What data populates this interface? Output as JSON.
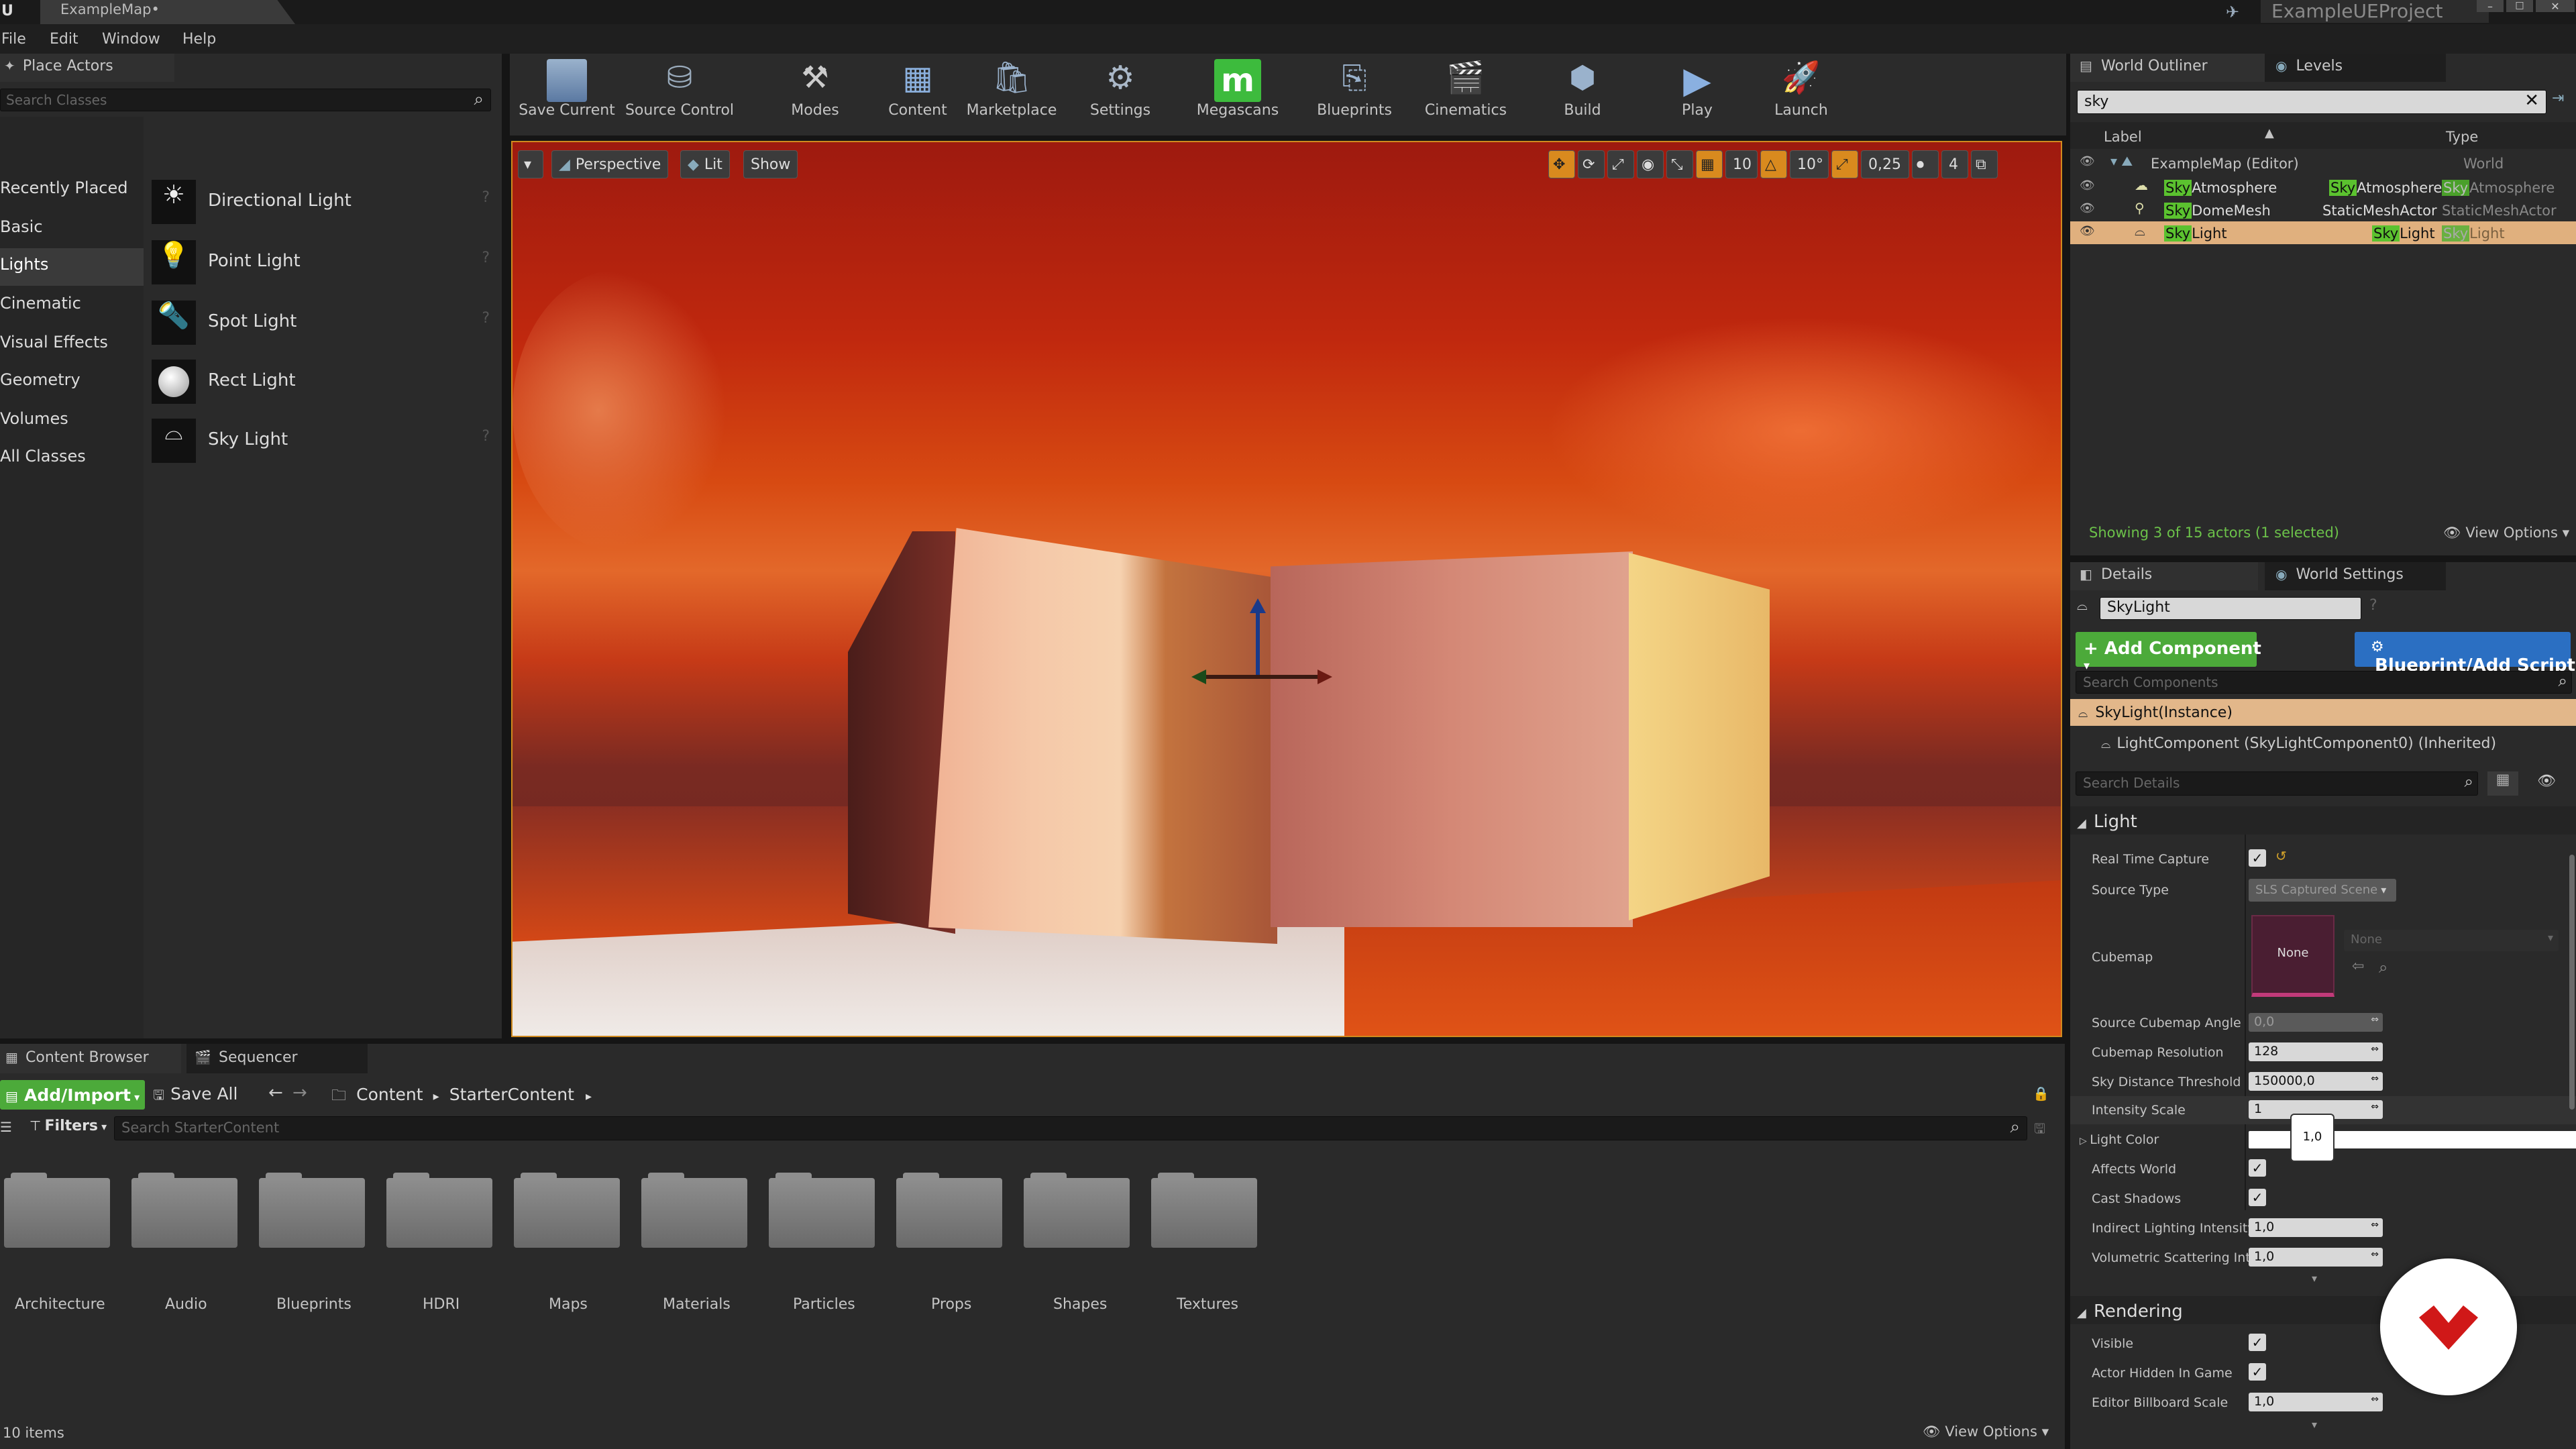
{
  "title_bar": {
    "tab": "ExampleMap",
    "project": "ExampleUEProject"
  },
  "menu": [
    "File",
    "Edit",
    "Window",
    "Help"
  ],
  "place_actors": {
    "tab": "Place Actors",
    "search_placeholder": "Search Classes",
    "categories": [
      "Recently Placed",
      "Basic",
      "Lights",
      "Cinematic",
      "Visual Effects",
      "Geometry",
      "Volumes",
      "All Classes"
    ],
    "selected_category": "Lights",
    "items": [
      "Directional Light",
      "Point Light",
      "Spot Light",
      "Rect Light",
      "Sky Light"
    ]
  },
  "toolbar": [
    "Save Current",
    "Source Control",
    "Modes",
    "Content",
    "Marketplace",
    "Settings",
    "Megascans",
    "Blueprints",
    "Cinematics",
    "Build",
    "Play",
    "Launch"
  ],
  "viewport": {
    "perspective": "Perspective",
    "lit": "Lit",
    "show": "Show",
    "grid_snap": "10",
    "rot_snap": "10°",
    "scale_snap": "0,25",
    "cam_speed": "4"
  },
  "world_outliner": {
    "tab": "World Outliner",
    "tab2": "Levels",
    "search_value": "sky",
    "col_label": "Label",
    "col_type": "Type",
    "rows": [
      {
        "label_pre": "",
        "label_hl": "",
        "label_post": "ExampleMap (Editor)",
        "type_pre": "",
        "type_hl": "",
        "type_post": "World"
      },
      {
        "label_pre": "",
        "label_hl": "Sky",
        "label_post": "Atmosphere",
        "type_pre": "",
        "type_hl": "Sky",
        "type_post": "Atmosphere"
      },
      {
        "label_pre": "",
        "label_hl": "Sky",
        "label_post": "DomeMesh",
        "type_pre": "StaticMeshActor",
        "type_hl": "",
        "type_post": ""
      },
      {
        "label_pre": "",
        "label_hl": "Sky",
        "label_post": "Light",
        "type_pre": "",
        "type_hl": "Sky",
        "type_post": "Light"
      }
    ],
    "row1_type_extra": "SkyAtmosphere",
    "row4_type_extra": "SkyLight",
    "status": "Showing 3 of 15 actors (1 selected)",
    "view_options": "View Options"
  },
  "details": {
    "tab": "Details",
    "tab2": "World Settings",
    "name": "SkyLight",
    "add_component": "+ Add Component",
    "blueprint": "Blueprint/Add Script",
    "search_components": "Search Components",
    "instance": "SkyLight(Instance)",
    "component": "LightComponent (SkyLightComponent0) (Inherited)",
    "search_details": "Search Details",
    "light_section": "Light",
    "props": {
      "real_time_capture": "Real Time Capture",
      "source_type": "Source Type",
      "source_type_value": "SLS Captured Scene",
      "cubemap": "Cubemap",
      "cubemap_value": "None",
      "cubemap_dropdown": "None",
      "source_cubemap_angle": "Source Cubemap Angle",
      "source_cubemap_angle_value": "0,0",
      "cubemap_resolution": "Cubemap Resolution",
      "cubemap_resolution_value": "128",
      "sky_distance_threshold": "Sky Distance Threshold",
      "sky_distance_threshold_value": "150000,0",
      "intensity_scale": "Intensity Scale",
      "intensity_scale_value": "1",
      "light_color": "Light Color",
      "light_color_tooltip": "1,0",
      "affects_world": "Affects World",
      "cast_shadows": "Cast Shadows",
      "indirect_lighting_intensity": "Indirect Lighting Intensity",
      "indirect_lighting_intensity_value": "1,0",
      "volumetric_scattering": "Volumetric Scattering Inte",
      "volumetric_scattering_value": "1,0"
    },
    "rendering_section": "Rendering",
    "render_props": {
      "visible": "Visible",
      "actor_hidden": "Actor Hidden In Game",
      "billboard_scale": "Editor Billboard Scale",
      "billboard_scale_value": "1,0"
    }
  },
  "content_browser": {
    "tab": "Content Browser",
    "tab2": "Sequencer",
    "add_import": "Add/Import",
    "save_all": "Save All",
    "path": [
      "Content",
      "StarterContent"
    ],
    "filters": "Filters",
    "search_placeholder": "Search StarterContent",
    "folders": [
      "Architecture",
      "Audio",
      "Blueprints",
      "HDRI",
      "Maps",
      "Materials",
      "Particles",
      "Props",
      "Shapes",
      "Textures"
    ],
    "count": "10 items",
    "view_options": "View Options"
  }
}
